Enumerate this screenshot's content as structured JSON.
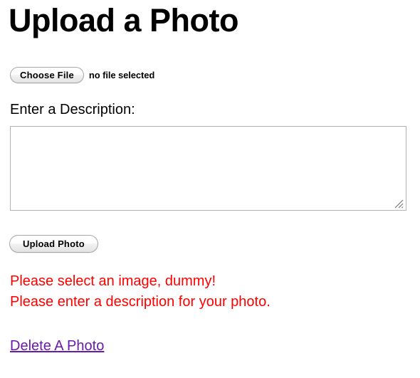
{
  "page": {
    "title": "Upload a Photo",
    "background_color": "#ffffff"
  },
  "file_input": {
    "button_label": "Choose File",
    "status_text": "no file selected"
  },
  "description_field": {
    "label": "Enter a Description:",
    "value": "",
    "placeholder": "",
    "resize_handle_icon": "resize-grip-icon"
  },
  "submit": {
    "label": "Upload Photo"
  },
  "errors": {
    "color": "#ff0000",
    "messages": [
      "Please select an image, dummy!",
      "Please enter a description for your photo."
    ]
  },
  "links": {
    "delete_photo": {
      "label": "Delete A Photo",
      "color": "#6a1aab"
    }
  }
}
